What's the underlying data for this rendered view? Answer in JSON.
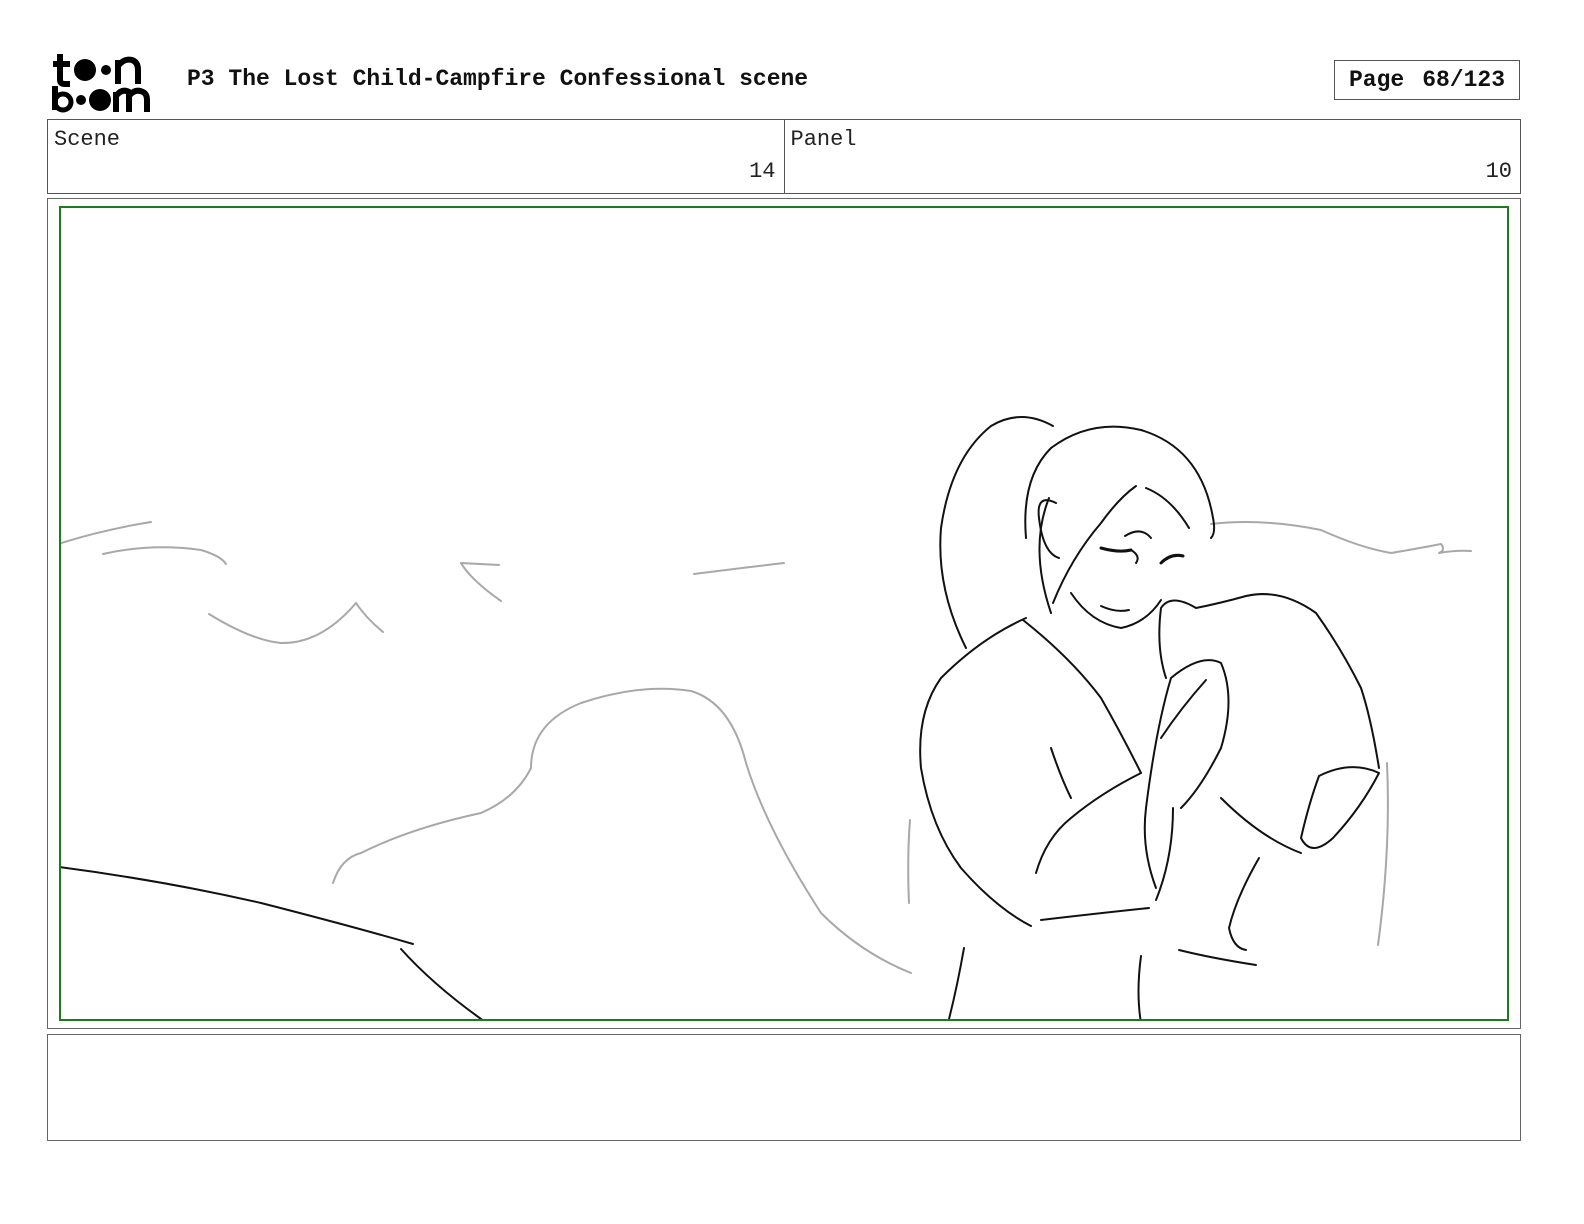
{
  "header": {
    "logo_text": "toon boom",
    "title": "P3 The Lost Child-Campfire Confessional scene",
    "page_label": "Page",
    "page_number": "68/123"
  },
  "info": {
    "scene_label": "Scene",
    "scene_value": "14",
    "panel_label": "Panel",
    "panel_value": "10"
  },
  "panel": {
    "image_name": "storyboard-sketch",
    "description_icon": "pencil-sketch-icon",
    "safe_frame_color": "#1e7a1e"
  },
  "notes": {
    "text": ""
  }
}
